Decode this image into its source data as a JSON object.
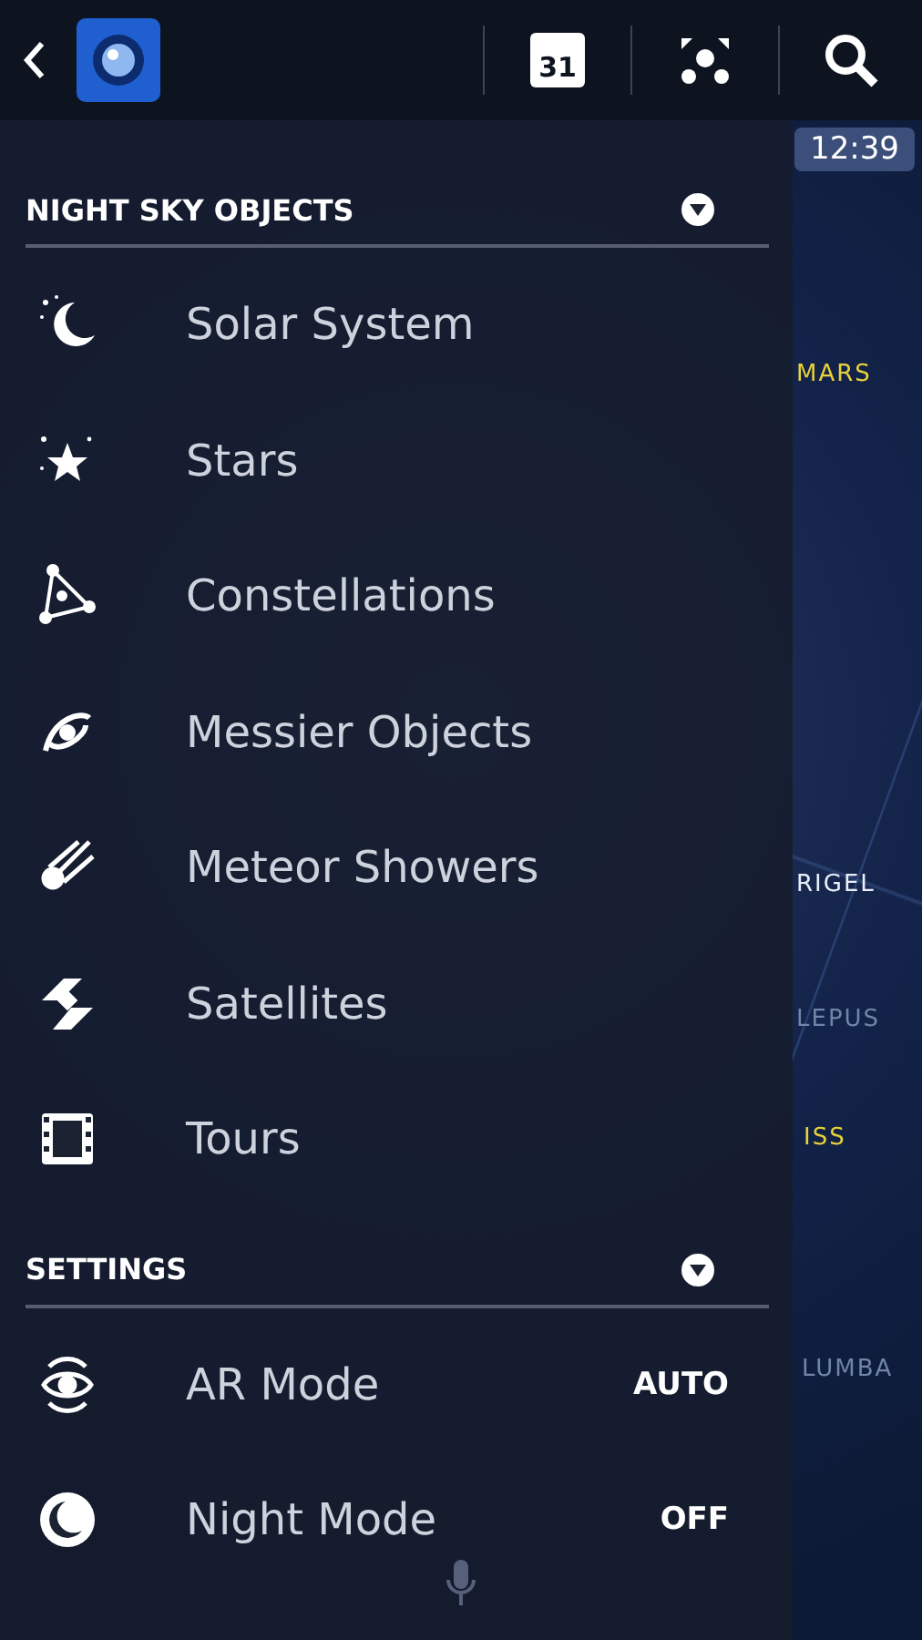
{
  "top_bar": {
    "calendar_day": "31"
  },
  "sky_map": {
    "time": "12:39",
    "labels": [
      {
        "text": "MARS",
        "kind": "planet"
      },
      {
        "text": "RIGEL",
        "kind": "star"
      },
      {
        "text": "LEPUS",
        "kind": "constellation"
      },
      {
        "text": "ISS",
        "kind": "planet"
      },
      {
        "text": "LUMBA",
        "kind": "constellation"
      }
    ]
  },
  "sections": [
    {
      "title": "NIGHT SKY OBJECTS",
      "expanded": true,
      "items": [
        {
          "label": "Solar System"
        },
        {
          "label": "Stars"
        },
        {
          "label": "Constellations"
        },
        {
          "label": "Messier Objects"
        },
        {
          "label": "Meteor Showers"
        },
        {
          "label": "Satellites"
        },
        {
          "label": "Tours"
        }
      ]
    },
    {
      "title": "SETTINGS",
      "expanded": true,
      "items": [
        {
          "label": "AR Mode",
          "value": "AUTO"
        },
        {
          "label": "Night Mode",
          "value": "OFF"
        }
      ]
    }
  ]
}
